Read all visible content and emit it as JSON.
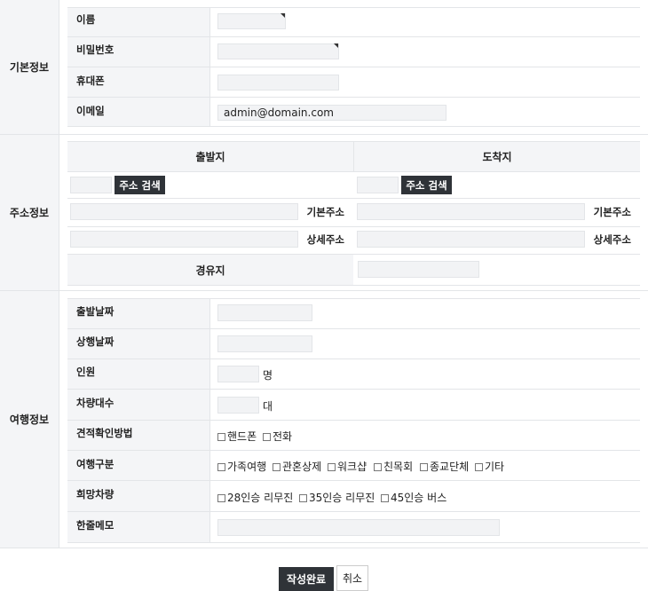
{
  "sections": {
    "basic": "기본정보",
    "address": "주소정보",
    "travel": "여행정보"
  },
  "basic": {
    "name_label": "이름",
    "password_label": "비밀번호",
    "phone_label": "휴대폰",
    "email_label": "이메일",
    "email_value": "admin@domain.com"
  },
  "address": {
    "departure_header": "출발지",
    "arrival_header": "도착지",
    "search_button": "주소 검색",
    "base_address": "기본주소",
    "detail_address": "상세주소",
    "waypoint_label": "경유지"
  },
  "travel": {
    "depart_date_label": "출발날짜",
    "return_date_label": "상행날짜",
    "people_label": "인원",
    "people_unit": "명",
    "vehicles_label": "차량대수",
    "vehicles_unit": "대",
    "confirm_label": "견적확인방법",
    "confirm_options": [
      "핸드폰",
      "전화"
    ],
    "type_label": "여행구분",
    "type_options": [
      "가족여행",
      "관혼상제",
      "워크샵",
      "친목회",
      "종교단체",
      "기타"
    ],
    "vehicle_label": "희망차량",
    "vehicle_options": [
      "28인승 리무진",
      "35인승 리무진",
      "45인승 버스"
    ],
    "memo_label": "한줄메모"
  },
  "actions": {
    "submit": "작성완료",
    "cancel": "취소"
  }
}
